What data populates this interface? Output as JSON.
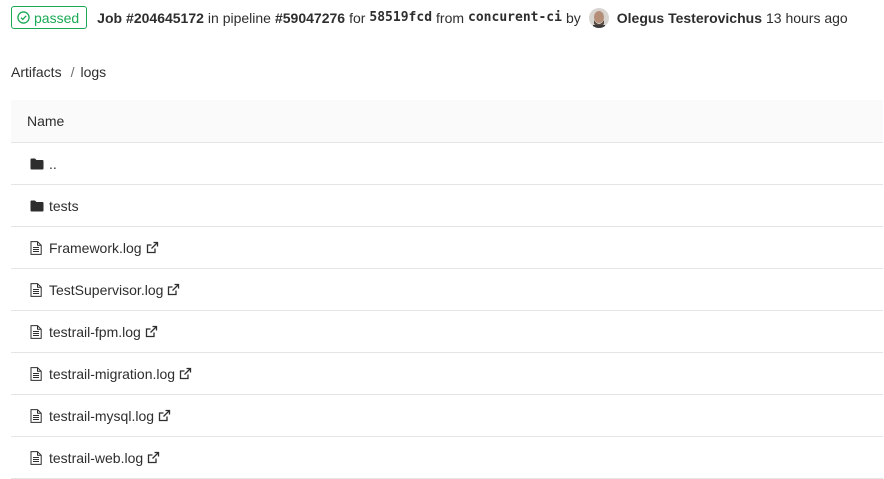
{
  "header": {
    "status": "passed",
    "job_prefix": "Job",
    "job_id": "#204645172",
    "in_pipeline": "in pipeline",
    "pipeline_id": "#59047276",
    "for": "for",
    "commit": "58519fcd",
    "from": "from",
    "branch": "concurent-ci",
    "by": "by",
    "user": "Olegus Testerovichus",
    "time": "13 hours ago"
  },
  "breadcrumb": {
    "root": "Artifacts",
    "separator": "/",
    "current": "logs"
  },
  "table": {
    "column": "Name",
    "rows": [
      {
        "name": "..",
        "kind": "folder"
      },
      {
        "name": "tests",
        "kind": "folder"
      },
      {
        "name": "Framework.log",
        "kind": "file"
      },
      {
        "name": "TestSupervisor.log",
        "kind": "file"
      },
      {
        "name": "testrail-fpm.log",
        "kind": "file"
      },
      {
        "name": "testrail-migration.log",
        "kind": "file"
      },
      {
        "name": "testrail-mysql.log",
        "kind": "file"
      },
      {
        "name": "testrail-web.log",
        "kind": "file"
      }
    ]
  },
  "colors": {
    "success": "#1aaa55",
    "border": "#e5e5e5",
    "header_bg": "#fafafa"
  }
}
